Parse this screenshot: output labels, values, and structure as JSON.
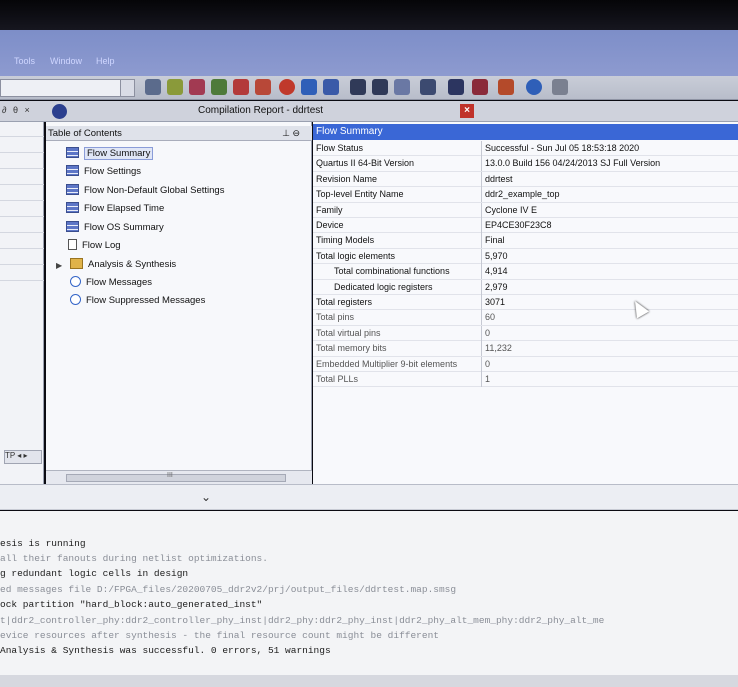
{
  "menubar": {
    "items": [
      "Tools",
      "Window",
      "Help"
    ]
  },
  "tab": {
    "title": "Compilation Report - ddrtest",
    "pin": "∂ θ ×"
  },
  "toc": {
    "header": "Table of Contents",
    "items": [
      {
        "label": "Flow Summary",
        "icon": "table-icon",
        "selected": true
      },
      {
        "label": "Flow Settings",
        "icon": "table-icon"
      },
      {
        "label": "Flow Non-Default Global Settings",
        "icon": "table-icon"
      },
      {
        "label": "Flow Elapsed Time",
        "icon": "table-icon"
      },
      {
        "label": "Flow OS Summary",
        "icon": "table-icon"
      },
      {
        "label": "Flow Log",
        "icon": "document-icon"
      },
      {
        "label": "Analysis & Synthesis",
        "icon": "folder-icon"
      },
      {
        "label": "Flow Messages",
        "icon": "info-icon"
      },
      {
        "label": "Flow Suppressed Messages",
        "icon": "info-icon"
      }
    ],
    "scroll_label": "III"
  },
  "left_panel": {
    "tp_label": "TP"
  },
  "summary": {
    "header": "Flow Summary",
    "rows": [
      {
        "key": "Flow Status",
        "value": "Successful - Sun Jul 05 18:53:18 2020"
      },
      {
        "key": "Quartus II 64-Bit Version",
        "value": "13.0.0 Build 156 04/24/2013 SJ Full Version"
      },
      {
        "key": "Revision Name",
        "value": "ddrtest"
      },
      {
        "key": "Top-level Entity Name",
        "value": "ddr2_example_top"
      },
      {
        "key": "Family",
        "value": "Cyclone IV E"
      },
      {
        "key": "Device",
        "value": "EP4CE30F23C8"
      },
      {
        "key": "Timing Models",
        "value": "Final"
      },
      {
        "key": "Total logic elements",
        "value": "5,970"
      },
      {
        "key": "Total combinational functions",
        "value": "4,914",
        "indent": true
      },
      {
        "key": "Dedicated logic registers",
        "value": "2,979",
        "indent": true
      },
      {
        "key": "Total registers",
        "value": "3071"
      },
      {
        "key": "Total pins",
        "value": "60"
      },
      {
        "key": "Total virtual pins",
        "value": "0"
      },
      {
        "key": "Total memory bits",
        "value": "11,232"
      },
      {
        "key": "Embedded Multiplier 9-bit elements",
        "value": "0"
      },
      {
        "key": "Total PLLs",
        "value": "1"
      }
    ]
  },
  "messages": [
    "esis is running",
    " all their fanouts during netlist optimizations.",
    "g redundant logic cells in design",
    "ed messages file D:/FPGA_files/20200705_ddr2v2/prj/output_files/ddrtest.map.smsg",
    "ock partition \"hard_block:auto_generated_inst\"",
    "t|ddr2_controller_phy:ddr2_controller_phy_inst|ddr2_phy:ddr2_phy_inst|ddr2_phy_alt_mem_phy:ddr2_phy_alt_me",
    "evice resources after synthesis - the final resource count might be different",
    "Analysis & Synthesis was successful. 0 errors, 51 warnings"
  ],
  "colors": {
    "header_blue": "#3a67d6",
    "close_red": "#c0322a"
  }
}
